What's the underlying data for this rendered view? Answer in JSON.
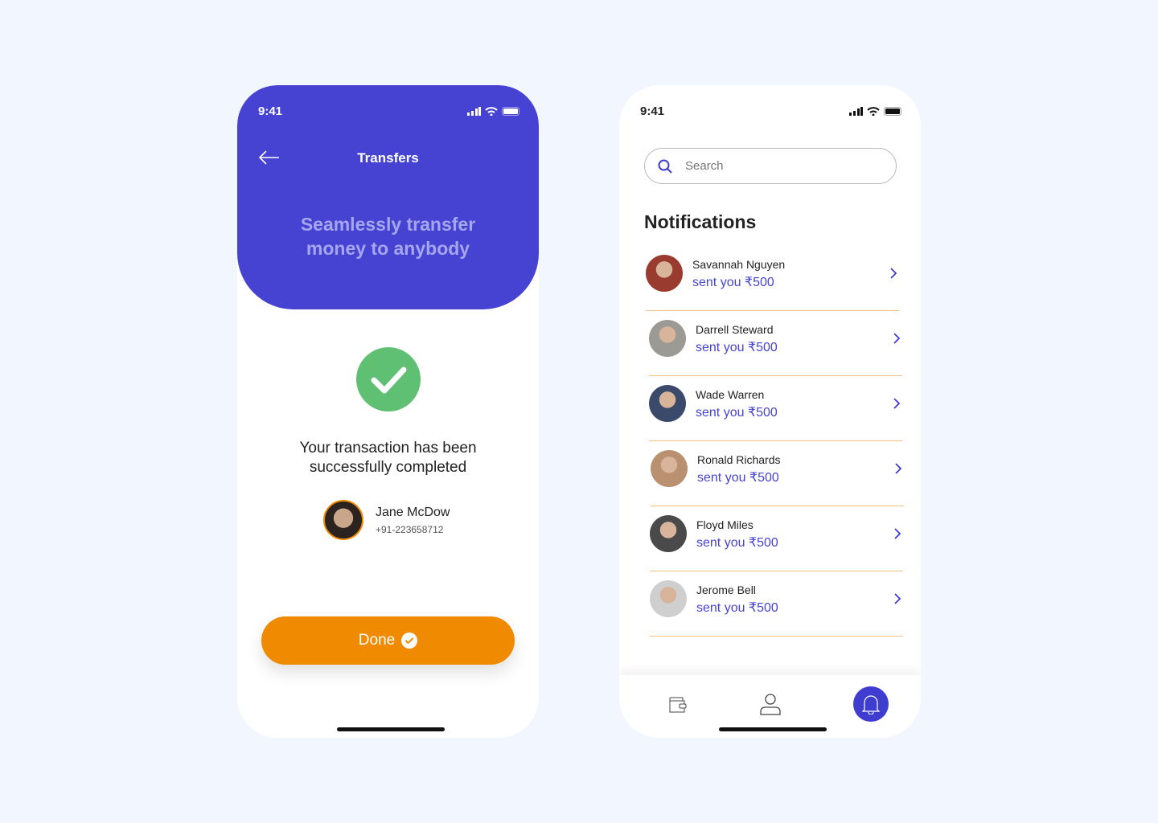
{
  "left": {
    "time": "9:41",
    "title": "Transfers",
    "tagline": [
      "Seamlessly transfer",
      "money to anybody"
    ],
    "message": [
      "Your transaction has been",
      "successfully completed"
    ],
    "recipient": {
      "name": "Jane McDow",
      "phone": "+91-223658712"
    },
    "done_label": "Done"
  },
  "right": {
    "time": "9:41",
    "search_placeholder": "Search",
    "heading": "Notifications",
    "items": [
      {
        "name": "Savannah Nguyen",
        "text": "sent you ₹500"
      },
      {
        "name": "Darrell Steward",
        "text": "sent you ₹500"
      },
      {
        "name": "Wade Warren",
        "text": "sent you ₹500"
      },
      {
        "name": "Ronald Richards",
        "text": "sent you ₹500"
      },
      {
        "name": "Floyd Miles",
        "text": "sent you ₹500"
      },
      {
        "name": "Jerome Bell",
        "text": "sent you ₹500"
      }
    ],
    "nav": [
      "wallet-icon",
      "user-icon",
      "bell-icon"
    ]
  },
  "colors": {
    "primary": "#4643d3",
    "accent": "#f08a00",
    "success": "#5fbf72"
  }
}
